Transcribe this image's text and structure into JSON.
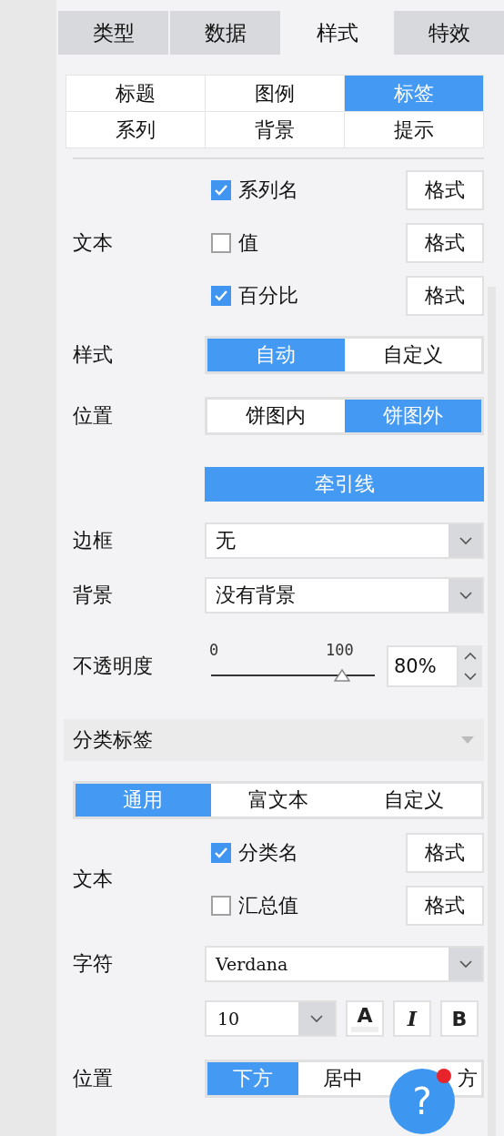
{
  "top_tabs": [
    {
      "label": "类型",
      "selected": false
    },
    {
      "label": "数据",
      "selected": false
    },
    {
      "label": "样式",
      "selected": true
    },
    {
      "label": "特效",
      "selected": false
    }
  ],
  "sub_tabs": [
    {
      "label": "标题",
      "selected": false
    },
    {
      "label": "图例",
      "selected": false
    },
    {
      "label": "标签",
      "selected": true
    },
    {
      "label": "系列",
      "selected": false
    },
    {
      "label": "背景",
      "selected": false
    },
    {
      "label": "提示",
      "selected": false
    }
  ],
  "label_section": {
    "text": {
      "label": "文本",
      "options": [
        {
          "label": "系列名",
          "checked": true,
          "format_button": "格式"
        },
        {
          "label": "值",
          "checked": false,
          "format_button": "格式"
        },
        {
          "label": "百分比",
          "checked": true,
          "format_button": "格式"
        }
      ]
    },
    "style": {
      "label": "样式",
      "options": [
        {
          "label": "自动",
          "selected": true
        },
        {
          "label": "自定义",
          "selected": false
        }
      ]
    },
    "position": {
      "label": "位置",
      "options": [
        {
          "label": "饼图内",
          "selected": false
        },
        {
          "label": "饼图外",
          "selected": true
        }
      ]
    },
    "leader_line_button": "牵引线",
    "border": {
      "label": "边框",
      "value": "无"
    },
    "background": {
      "label": "背景",
      "value": "没有背景"
    },
    "opacity": {
      "label": "不透明度",
      "min_label": "0",
      "max_label": "100",
      "level": 0.8,
      "value": "80%"
    }
  },
  "category_section": {
    "title": "分类标签",
    "expanded": true,
    "modes": [
      {
        "label": "通用",
        "selected": true
      },
      {
        "label": "富文本",
        "selected": false
      },
      {
        "label": "自定义",
        "selected": false
      }
    ],
    "text": {
      "label": "文本",
      "options": [
        {
          "label": "分类名",
          "checked": true,
          "format_button": "格式"
        },
        {
          "label": "汇总值",
          "checked": false,
          "format_button": "格式"
        }
      ]
    },
    "font": {
      "label": "字符",
      "value": "Verdana",
      "size": "10",
      "color_button": "A",
      "italic_button": "I",
      "bold_button": "B"
    },
    "position": {
      "label": "位置",
      "options": [
        {
          "label": "下方",
          "selected": true
        },
        {
          "label": "居中",
          "selected": false
        },
        {
          "label": "方",
          "selected": false
        }
      ]
    }
  },
  "help_button": {
    "label": "?",
    "notification": true
  }
}
